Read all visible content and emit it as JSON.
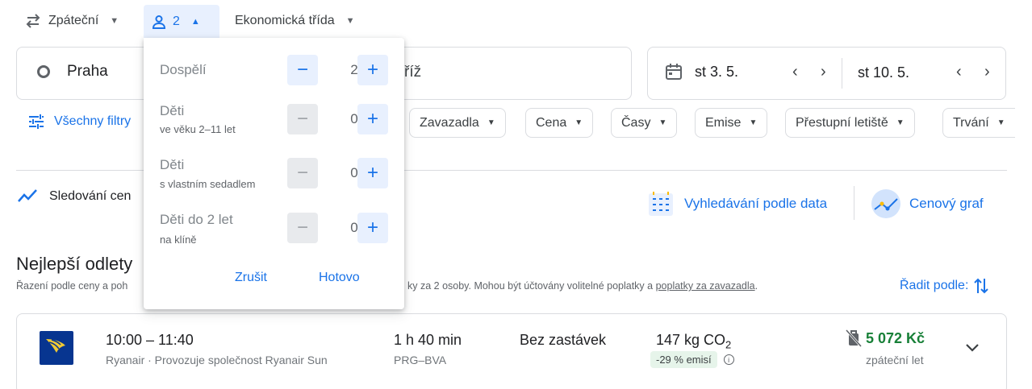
{
  "top": {
    "trip_type": "Zpáteční",
    "passengers": "2",
    "cabin": "Ekonomická třída"
  },
  "search": {
    "origin": "Praha",
    "destination_partial": "říž",
    "depart_date": "st 3. 5.",
    "return_date": "st 10. 5."
  },
  "filters": {
    "all_filters": "Všechny filtry",
    "chips": [
      "Zavazadla",
      "Cena",
      "Časy",
      "Emise",
      "Přestupní letiště",
      "Trvání"
    ]
  },
  "tools": {
    "price_tracking": "Sledování cen",
    "date_search": "Vyhledávání podle data",
    "price_graph": "Cenový graf"
  },
  "results": {
    "heading": "Nejlepší odlety",
    "sort_note_start": "Řazení podle ceny a poh",
    "sort_note_end": "ky za 2 osoby. Mohou být účtovány volitelné poplatky a ",
    "baggage_fees_link": "poplatky za zavazadla",
    "sort_note_tail": ".",
    "sort_button": "Řadit podle:"
  },
  "passenger_popup": {
    "rows": [
      {
        "label": "Dospělí",
        "sub": "",
        "count": "2",
        "minus_enabled": true
      },
      {
        "label": "Děti",
        "sub": "ve věku 2–11 let",
        "count": "0",
        "minus_enabled": false
      },
      {
        "label": "Děti",
        "sub": "s vlastním sedadlem",
        "count": "0",
        "minus_enabled": false
      },
      {
        "label": "Děti do 2 let",
        "sub": "na klíně",
        "count": "0",
        "minus_enabled": false
      }
    ],
    "cancel": "Zrušit",
    "done": "Hotovo"
  },
  "flight": {
    "times": "10:00 – 11:40",
    "airline": "Ryanair · Provozuje společnost Ryanair Sun",
    "duration": "1 h 40 min",
    "route": "PRG–BVA",
    "stops": "Bez zastávek",
    "emissions": "147 kg CO",
    "emissions_sub": "2",
    "emissions_badge": "-29 % emisí",
    "price": "5 072 Kč",
    "price_type": "zpáteční let"
  },
  "colors": {
    "accent": "#1a73e8",
    "price_green": "#188038",
    "badge_bg": "#e6f4ea",
    "ryanair_blue": "#073590",
    "ryanair_gold": "#f1c933"
  }
}
